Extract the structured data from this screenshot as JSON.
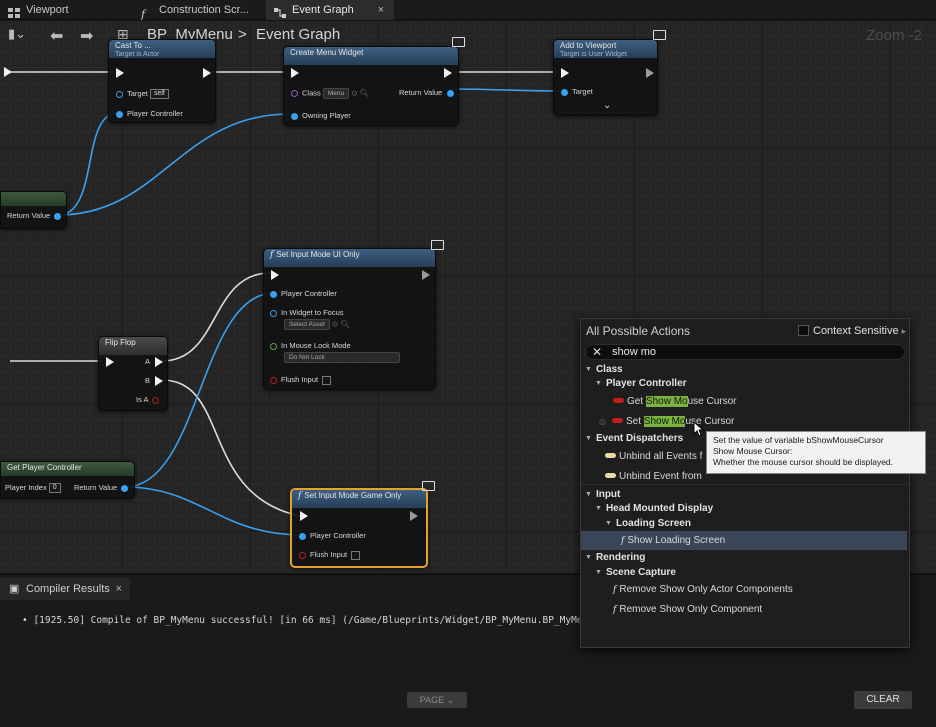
{
  "tabs": [
    {
      "label": "Viewport",
      "icon": "grid-icon"
    },
    {
      "label": "Construction Scr...",
      "icon": "function-icon"
    },
    {
      "label": "Event Graph",
      "icon": "graph-icon",
      "active": true,
      "close": "×"
    }
  ],
  "breadcrumb": {
    "blueprint": "BP_MyMenu",
    "separator": ">",
    "graph": "Event Graph"
  },
  "zoom": "Zoom -2",
  "nodes": {
    "cast": {
      "title": "Cast To ...",
      "subtitle": "Target is Actor",
      "target_label": "Target",
      "target_value": "self",
      "player_controller": "Player Controller"
    },
    "create_widget": {
      "title": "Create Menu Widget",
      "class_label": "Class",
      "class_value": "Menu",
      "return_value": "Return Value",
      "owning_player": "Owning Player"
    },
    "add_to_viewport": {
      "title": "Add to Viewport",
      "subtitle": "Target is User Widget",
      "target": "Target"
    },
    "left_getter": {
      "return_value": "Return Value"
    },
    "set_input_ui": {
      "title": "Set Input Mode UI Only",
      "player_controller": "Player Controller",
      "widget_focus": "In Widget to Focus",
      "widget_focus_value": "Select Asset",
      "lock_mode": "In Mouse Lock Mode",
      "lock_mode_value": "Do Not Lock",
      "flush": "Flush Input"
    },
    "flip_flop": {
      "title": "Flip Flop",
      "a": "A",
      "b": "B",
      "is_a": "Is A"
    },
    "get_player_controller": {
      "title": "Get Player Controller",
      "player_index": "Player Index",
      "player_index_value": "0",
      "return_value": "Return Value"
    },
    "set_input_game": {
      "title": "Set Input Mode Game Only",
      "player_controller": "Player Controller",
      "flush": "Flush Input"
    }
  },
  "action_menu": {
    "title": "All Possible Actions",
    "context_sensitive": "Context Sensitive",
    "search_value": "show mo",
    "rows": [
      {
        "kind": "cat",
        "label": "Class"
      },
      {
        "kind": "cat",
        "label": "Player Controller"
      },
      {
        "kind": "var",
        "prefix": "Get ",
        "match": "Show Mo",
        "suffix": "use Cursor"
      },
      {
        "kind": "var",
        "prefix": "Set ",
        "match": "Show Mo",
        "suffix": "use Cursor"
      },
      {
        "kind": "cat",
        "label": "Event Dispatchers"
      },
      {
        "kind": "ev",
        "label": "Unbind all Events f"
      },
      {
        "kind": "ev",
        "label": "Unbind Event from"
      },
      {
        "kind": "cat",
        "label": "Input"
      },
      {
        "kind": "cat",
        "label": "Head Mounted Display"
      },
      {
        "kind": "cat",
        "label": "Loading Screen"
      },
      {
        "kind": "fn",
        "label": "Show Loading Screen",
        "highlight": true
      },
      {
        "kind": "cat",
        "label": "Rendering"
      },
      {
        "kind": "cat",
        "label": "Scene Capture"
      },
      {
        "kind": "fn",
        "label": "Remove Show Only Actor Components"
      },
      {
        "kind": "fn",
        "label": "Remove Show Only Component"
      }
    ]
  },
  "tooltip": {
    "line1": "Set the value of variable bShowMouseCursor",
    "line2": "Show Mouse Cursor:",
    "line3": "Whether the mouse cursor should be displayed."
  },
  "bottom_panel": {
    "tab": "Compiler Results",
    "log": "• [1925.50] Compile of BP_MyMenu successful! [in 66 ms] (/Game/Blueprints/Widget/BP_MyMenu.BP_MyMe",
    "page_button": "PAGE ⌄",
    "clear_button": "CLEAR"
  },
  "colors": {
    "exec": "#f2f2f2",
    "object_pin": "#3aa0f0",
    "class_pin": "#8b5cd6",
    "bool_pin": "#b52020",
    "selection": "#e5a12a",
    "search_match": "#7bb342"
  }
}
